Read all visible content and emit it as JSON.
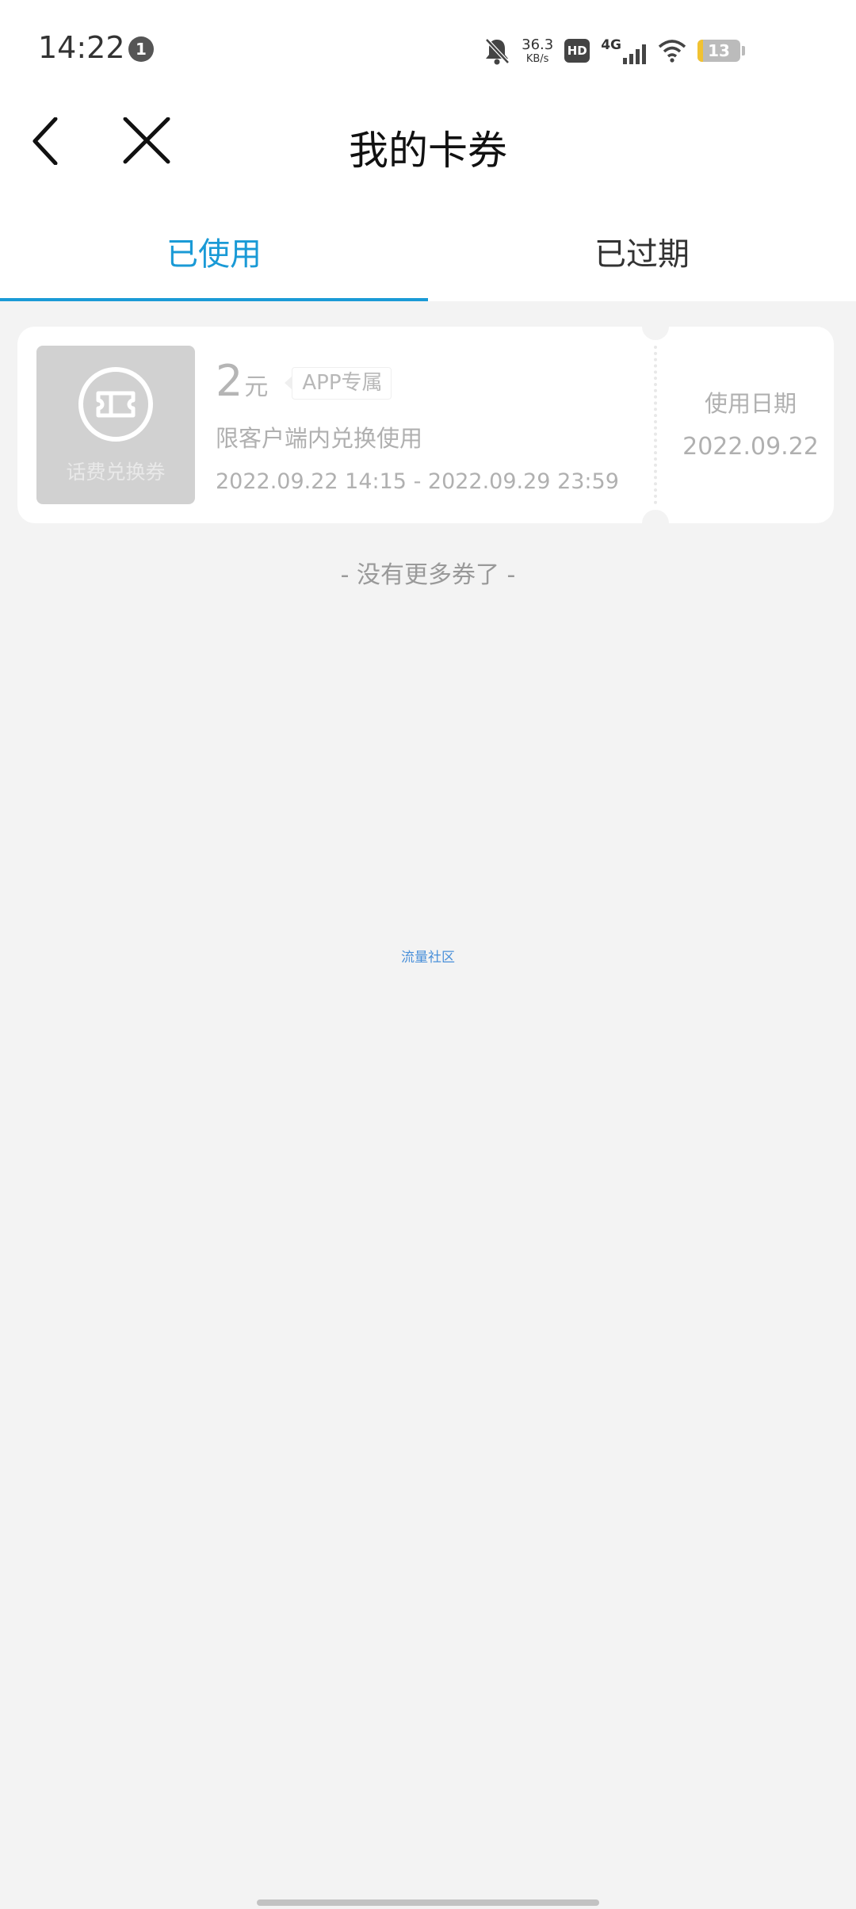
{
  "status_bar": {
    "time": "14:22",
    "notification_count": "1",
    "net_speed": "36.3",
    "net_unit": "KB/s",
    "hd_label": "HD",
    "network_label": "4G",
    "battery_level": "13",
    "battery_color": "#f1c232"
  },
  "header": {
    "title": "我的卡券",
    "back_icon": "chevron-left-icon",
    "close_icon": "close-icon"
  },
  "tabs": [
    {
      "label": "已使用",
      "active": true
    },
    {
      "label": "已过期",
      "active": false
    }
  ],
  "accent_color": "#1a9ad6",
  "coupons": [
    {
      "thumb_label": "话费兑换券",
      "amount": "2",
      "currency": "元",
      "tag": "APP专属",
      "description": "限客户端内兑换使用",
      "validity": "2022.09.22 14:15 - 2022.09.29 23:59",
      "used_label": "使用日期",
      "used_date": "2022.09.22"
    }
  ],
  "footer": {
    "no_more": "- 没有更多券了 -",
    "watermark": "流量社区"
  }
}
